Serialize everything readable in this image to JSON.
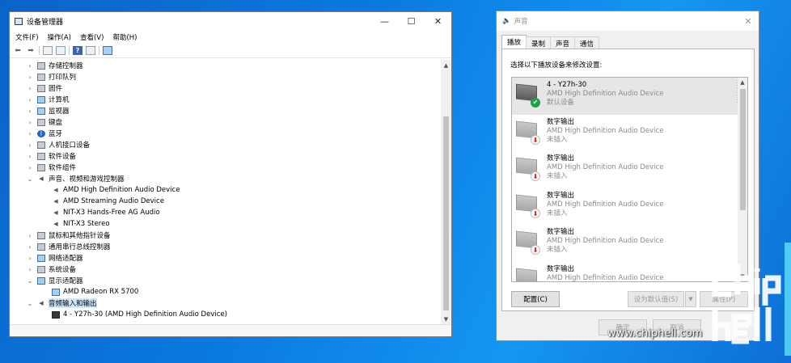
{
  "device_manager": {
    "title": "设备管理器",
    "window_controls": [
      "—",
      "☐",
      "✕"
    ],
    "menu": [
      "文件(F)",
      "操作(A)",
      "查看(V)",
      "帮助(H)"
    ],
    "tree": [
      {
        "label": "存储控制器",
        "expanded": false,
        "icon": "storage-controller-icon"
      },
      {
        "label": "打印队列",
        "expanded": false,
        "icon": "printer-icon"
      },
      {
        "label": "固件",
        "expanded": false,
        "icon": "firmware-icon"
      },
      {
        "label": "计算机",
        "expanded": false,
        "icon": "computer-icon"
      },
      {
        "label": "监视器",
        "expanded": false,
        "icon": "monitor-icon"
      },
      {
        "label": "键盘",
        "expanded": false,
        "icon": "keyboard-icon"
      },
      {
        "label": "蓝牙",
        "expanded": false,
        "icon": "bluetooth-icon"
      },
      {
        "label": "人机接口设备",
        "expanded": false,
        "icon": "hid-icon"
      },
      {
        "label": "软件设备",
        "expanded": false,
        "icon": "software-device-icon"
      },
      {
        "label": "软件组件",
        "expanded": false,
        "icon": "software-component-icon"
      },
      {
        "label": "声音、视频和游戏控制器",
        "expanded": true,
        "icon": "speaker-icon"
      },
      {
        "label": "AMD High Definition Audio Device",
        "child": true,
        "icon": "speaker-icon"
      },
      {
        "label": "AMD Streaming Audio Device",
        "child": true,
        "icon": "speaker-icon"
      },
      {
        "label": "NIT-X3 Hands-Free AG Audio",
        "child": true,
        "icon": "speaker-icon"
      },
      {
        "label": "NIT-X3 Stereo",
        "child": true,
        "icon": "speaker-icon"
      },
      {
        "label": "鼠标和其他指针设备",
        "expanded": false,
        "icon": "mouse-icon"
      },
      {
        "label": "通用串行总线控制器",
        "expanded": false,
        "icon": "usb-icon"
      },
      {
        "label": "网络适配器",
        "expanded": false,
        "icon": "network-adapter-icon"
      },
      {
        "label": "系统设备",
        "expanded": false,
        "icon": "system-device-icon"
      },
      {
        "label": "显示适配器",
        "expanded": true,
        "icon": "display-adapter-icon"
      },
      {
        "label": "AMD Radeon RX 5700",
        "child": true,
        "icon": "display-adapter-icon"
      },
      {
        "label": "音频输入和输出",
        "expanded": true,
        "icon": "speaker-icon",
        "selected": true
      },
      {
        "label": "4 - Y27h-30 (AMD High Definition Audio Device)",
        "child": true,
        "icon": "monitor-dark-icon"
      }
    ]
  },
  "sound": {
    "title": "声音",
    "tabs": [
      "播放",
      "录制",
      "声音",
      "通信"
    ],
    "instruction": "选择以下播放设备来修改设置:",
    "devices": [
      {
        "name": "4 - Y27h-30",
        "desc": "AMD High Definition Audio Device",
        "status": "默认设备",
        "badge": "✔",
        "badge_type": "ok",
        "selected": true
      },
      {
        "name": "数字输出",
        "desc": "AMD High Definition Audio Device",
        "status": "未插入",
        "badge": "⬇",
        "badge_type": "down"
      },
      {
        "name": "数字输出",
        "desc": "AMD High Definition Audio Device",
        "status": "未插入",
        "badge": "⬇",
        "badge_type": "down"
      },
      {
        "name": "数字输出",
        "desc": "AMD High Definition Audio Device",
        "status": "未插入",
        "badge": "⬇",
        "badge_type": "down"
      },
      {
        "name": "数字输出",
        "desc": "AMD High Definition Audio Device",
        "status": "未插入",
        "badge": "⬇",
        "badge_type": "down"
      },
      {
        "name": "数字输出",
        "desc": "AMD High Definition Audio Device",
        "status": "",
        "badge": "⬇",
        "badge_type": "down"
      }
    ],
    "buttons": {
      "configure": "配置(C)",
      "set_default": "设为默认值(S)",
      "properties": "属性(P)",
      "ok": "确定",
      "cancel": "取消"
    }
  },
  "watermark": {
    "text": "www.chiphell.com",
    "logo_text": "chip hell"
  }
}
